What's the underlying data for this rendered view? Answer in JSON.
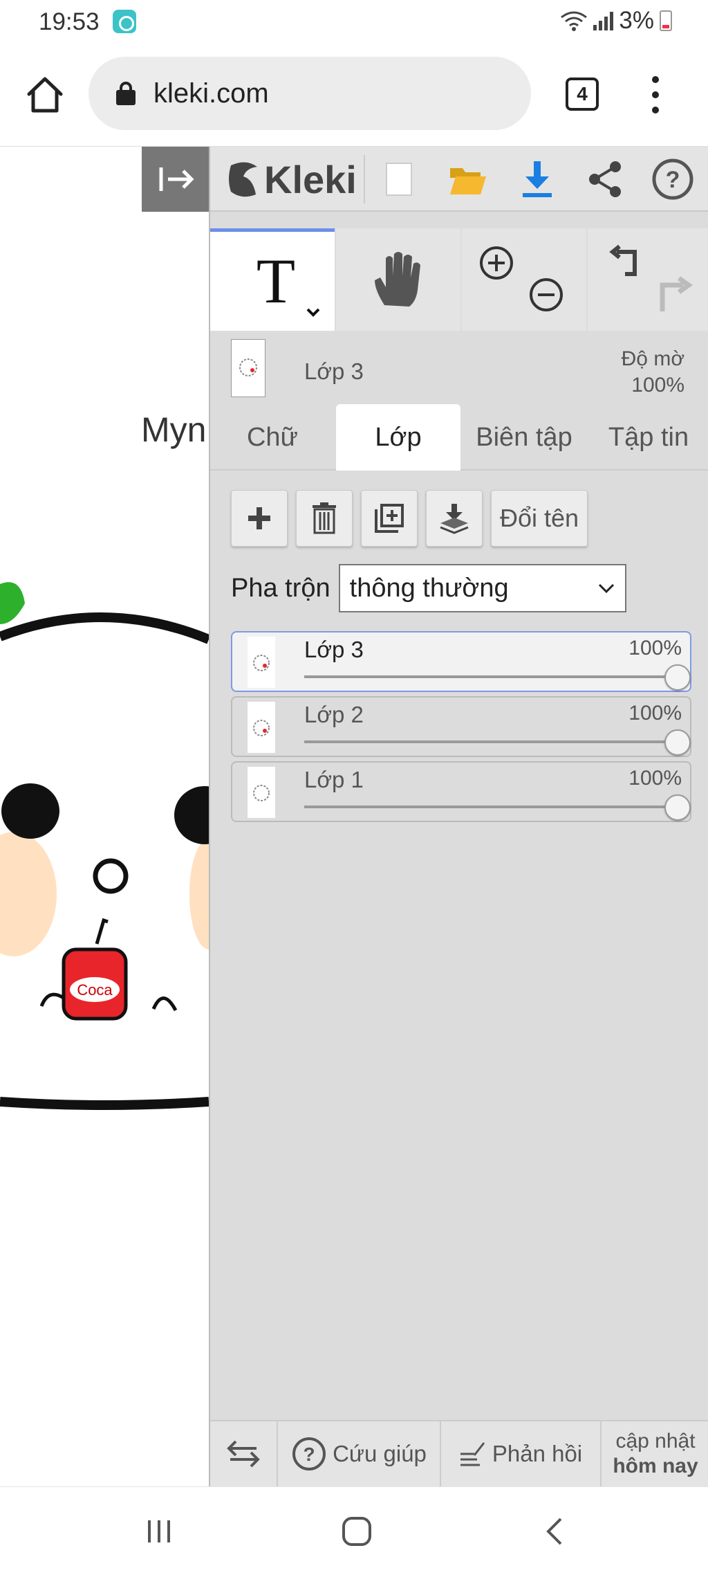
{
  "status_bar": {
    "time": "19:53",
    "battery": "3%"
  },
  "browser": {
    "url": "kleki.com",
    "tab_count": "4"
  },
  "canvas": {
    "visible_text": "Myn",
    "cup_text": "Coca"
  },
  "app": {
    "logo_text": "Kleki"
  },
  "current_layer": {
    "name": "Lớp 3",
    "opacity_label": "Độ mờ",
    "opacity_value": "100%"
  },
  "tabs": [
    {
      "label": "Chữ",
      "active": false
    },
    {
      "label": "Lớp",
      "active": true
    },
    {
      "label": "Biên tập",
      "active": false
    },
    {
      "label": "Tập tin",
      "active": false
    }
  ],
  "layer_actions": {
    "rename_label": "Đổi tên"
  },
  "blend": {
    "label": "Pha trộn",
    "value": "thông thường"
  },
  "layers": [
    {
      "name": "Lớp 3",
      "opacity": "100%",
      "opacity_fraction": 1.0,
      "selected": true
    },
    {
      "name": "Lớp 2",
      "opacity": "100%",
      "opacity_fraction": 1.0,
      "selected": false
    },
    {
      "name": "Lớp 1",
      "opacity": "100%",
      "opacity_fraction": 1.0,
      "selected": false
    }
  ],
  "bottom_bar": {
    "help_label": "Cứu giúp",
    "feedback_label": "Phản hồi",
    "update_line1": "cập nhật",
    "update_line2": "hôm nay"
  },
  "colors": {
    "accent": "#6b8fe8",
    "download_blue": "#1a7fe0",
    "folder_yellow": "#f5b82e",
    "cup_red": "#e8252a",
    "cheek": "#ffe0c0",
    "leaf_green": "#2db12d"
  },
  "icons": [
    "home-icon",
    "lock-icon",
    "menu-dots-icon",
    "collapse-panel-icon",
    "new-file-icon",
    "open-folder-icon",
    "download-icon",
    "share-icon",
    "help-icon",
    "text-tool-icon",
    "hand-tool-icon",
    "zoom-in-icon",
    "zoom-out-icon",
    "undo-icon",
    "redo-icon",
    "add-layer-icon",
    "delete-layer-icon",
    "duplicate-layer-icon",
    "merge-down-icon",
    "swap-icon",
    "help-circle-icon",
    "feedback-icon"
  ]
}
